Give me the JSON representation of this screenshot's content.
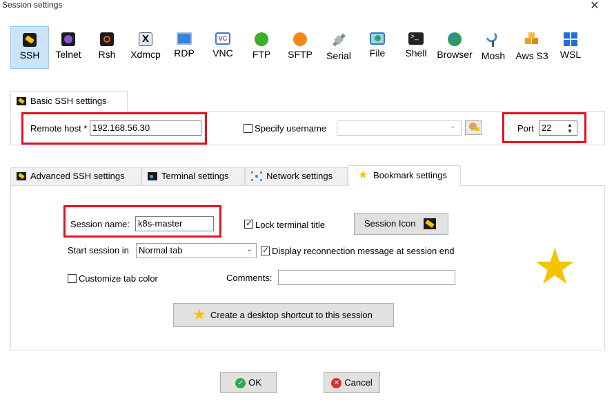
{
  "window": {
    "title": "Session settings",
    "close_glyph": "✕"
  },
  "protocols": [
    {
      "label": "SSH",
      "icon": "ssh-key-icon",
      "color": "#f5c400",
      "selected": true
    },
    {
      "label": "Telnet",
      "icon": "telnet-icon",
      "color": "#8a4fd6"
    },
    {
      "label": "Rsh",
      "icon": "rsh-icon",
      "color": "#e06010"
    },
    {
      "label": "Xdmcp",
      "icon": "xdmcp-icon",
      "color": "#4a4a4a"
    },
    {
      "label": "RDP",
      "icon": "rdp-icon",
      "color": "#2e86de"
    },
    {
      "label": "VNC",
      "icon": "vnc-icon",
      "color": "#3a7bd5"
    },
    {
      "label": "FTP",
      "icon": "ftp-icon",
      "color": "#3cae28"
    },
    {
      "label": "SFTP",
      "icon": "sftp-icon",
      "color": "#f28a1a"
    },
    {
      "label": "Serial",
      "icon": "serial-icon",
      "color": "#7f8c8d"
    },
    {
      "label": "File",
      "icon": "file-icon",
      "color": "#2980b9"
    },
    {
      "label": "Shell",
      "icon": "shell-icon",
      "color": "#222222"
    },
    {
      "label": "Browser",
      "icon": "browser-icon",
      "color": "#2a9d5c"
    },
    {
      "label": "Mosh",
      "icon": "mosh-icon",
      "color": "#3b8fd8"
    },
    {
      "label": "Aws S3",
      "icon": "aws-s3-icon",
      "color": "#f0a020"
    },
    {
      "label": "WSL",
      "icon": "wsl-icon",
      "color": "#1e6fd9"
    }
  ],
  "basic": {
    "tab_label": "Basic SSH settings",
    "remote_host_label": "Remote host *",
    "remote_host_value": "192.168.56.30",
    "specify_username_label": "Specify username",
    "specify_username_checked": false,
    "username_value": "",
    "port_label": "Port",
    "port_value": "22"
  },
  "tabs": [
    {
      "label": "Advanced SSH settings",
      "icon": "key-icon"
    },
    {
      "label": "Terminal settings",
      "icon": "terminal-icon"
    },
    {
      "label": "Network settings",
      "icon": "network-icon"
    },
    {
      "label": "Bookmark settings",
      "icon": "star-icon",
      "active": true
    }
  ],
  "bookmark": {
    "session_name_label": "Session name:",
    "session_name_value": "k8s-master",
    "lock_title_label": "Lock terminal title",
    "lock_title_checked": true,
    "session_icon_label": "Session Icon",
    "start_in_label": "Start session in",
    "start_in_value": "Normal tab",
    "reconnect_label": "Display reconnection message at session end",
    "reconnect_checked": true,
    "customize_color_label": "Customize tab color",
    "customize_color_checked": false,
    "comments_label": "Comments:",
    "comments_value": "",
    "shortcut_label": "Create a desktop shortcut to this session"
  },
  "footer": {
    "ok_label": "OK",
    "cancel_label": "Cancel"
  },
  "colors": {
    "highlight_red": "#e3101d",
    "star_yellow": "#f5c400",
    "selected_bg": "#cce4f7"
  }
}
